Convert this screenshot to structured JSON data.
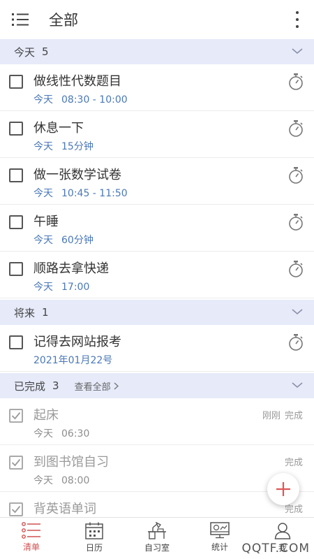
{
  "header": {
    "title": "全部"
  },
  "sections": {
    "today": {
      "name": "今天",
      "count": "5"
    },
    "future": {
      "name": "将来",
      "count": "1"
    },
    "completed": {
      "name": "已完成",
      "count": "3",
      "view_all": "查看全部"
    }
  },
  "today_items": [
    {
      "title": "做线性代数题目",
      "day": "今天",
      "time": "08:30 - 10:00"
    },
    {
      "title": "休息一下",
      "day": "今天",
      "time": "15分钟"
    },
    {
      "title": "做一张数学试卷",
      "day": "今天",
      "time": "10:45 - 11:50"
    },
    {
      "title": "午睡",
      "day": "今天",
      "time": "60分钟"
    },
    {
      "title": "顺路去拿快递",
      "day": "今天",
      "time": "17:00"
    }
  ],
  "future_items": [
    {
      "title": "记得去网站报考",
      "date": "2021年01月22号"
    }
  ],
  "completed_items": [
    {
      "title": "起床",
      "day": "今天",
      "time": "06:30",
      "when": "刚刚",
      "status": "完成"
    },
    {
      "title": "到图书馆自习",
      "day": "今天",
      "time": "08:00",
      "status": "完成"
    },
    {
      "title": "背英语单词",
      "status": "完成"
    }
  ],
  "bottom_nav": {
    "list": "清单",
    "calendar": "日历",
    "study_room": "自习室",
    "stats": "统计",
    "me": "我"
  },
  "watermark": "QQTF.COM",
  "colors": {
    "section_bg": "#e6eaf9",
    "accent_blue": "#4a78b8",
    "accent_red": "#d05050"
  }
}
